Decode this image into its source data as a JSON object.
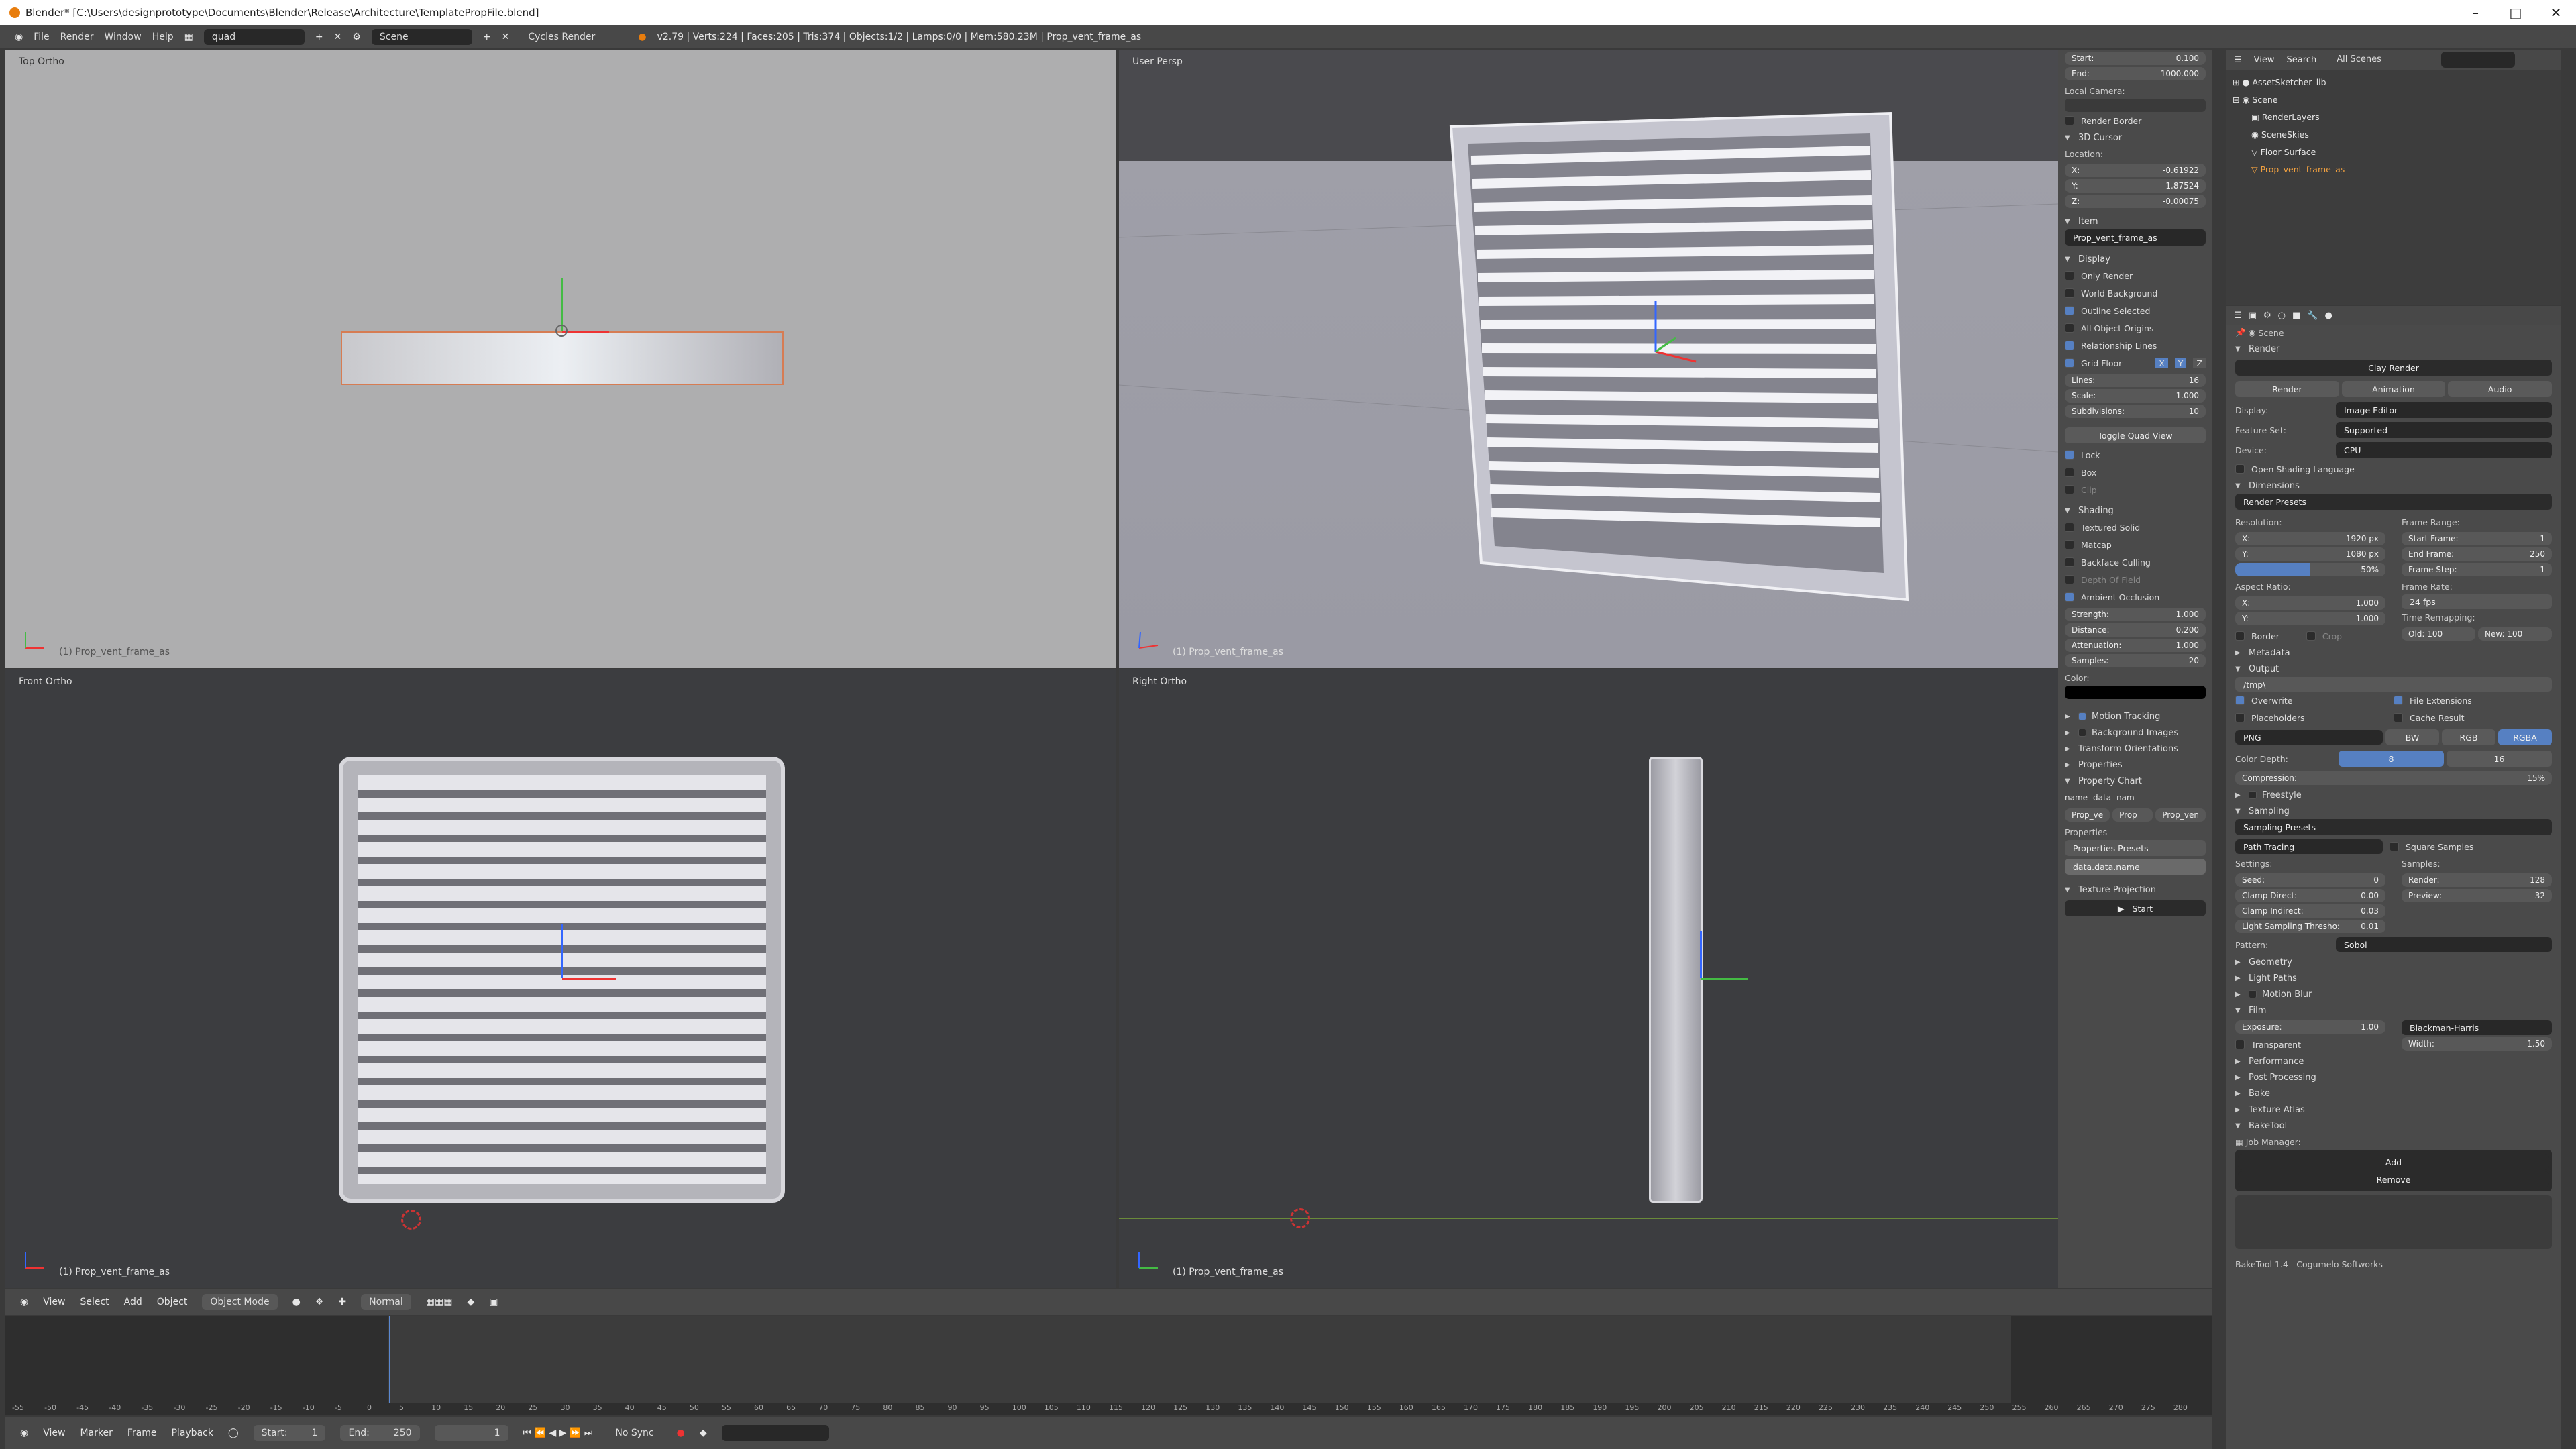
{
  "window": {
    "title": "Blender* [C:\\Users\\designprototype\\Documents\\Blender\\Release\\Architecture\\TemplatePropFile.blend]"
  },
  "topbar": {
    "menus": [
      "File",
      "Render",
      "Window",
      "Help"
    ],
    "screen": "quad",
    "scene": "Scene",
    "engine": "Cycles Render",
    "stats": "v2.79 | Verts:224 | Faces:205 | Tris:374 | Objects:1/2 | Lamps:0/0 | Mem:580.23M | Prop_vent_frame_as"
  },
  "viewports": {
    "top_left": "Top Ortho",
    "top_right": "User Persp",
    "bottom_left": "Front Ortho",
    "bottom_right": "Right Ortho",
    "object": "(1) Prop_vent_frame_as"
  },
  "npanel": {
    "clip_start": {
      "label": "Start:",
      "value": "0.100"
    },
    "clip_end": {
      "label": "End:",
      "value": "1000.000"
    },
    "local_camera": "Local Camera:",
    "render_border": "Render Border",
    "cursor_title": "3D Cursor",
    "location": "Location:",
    "cursor": [
      {
        "label": "X:",
        "value": "-0.61922"
      },
      {
        "label": "Y:",
        "value": "-1.87524"
      },
      {
        "label": "Z:",
        "value": "-0.00075"
      }
    ],
    "item_title": "Item",
    "item_name": "Prop_vent_frame_as",
    "display_title": "Display",
    "display_opts": [
      "Only Render",
      "World Background",
      "Outline Selected",
      "All Object Origins",
      "Relationship Lines"
    ],
    "grid_floor": "Grid Floor",
    "grid_axes": [
      "X",
      "Y",
      "Z"
    ],
    "grid": [
      {
        "label": "Lines:",
        "value": "16"
      },
      {
        "label": "Scale:",
        "value": "1.000"
      },
      {
        "label": "Subdivisions:",
        "value": "10"
      }
    ],
    "toggle_quad": "Toggle Quad View",
    "quad_opts": [
      "Lock",
      "Box",
      "Clip"
    ],
    "shading_title": "Shading",
    "shading_opts": [
      "Textured Solid",
      "Matcap",
      "Backface Culling",
      "Depth Of Field",
      "Ambient Occlusion"
    ],
    "ao": [
      {
        "label": "Strength:",
        "value": "1.000"
      },
      {
        "label": "Distance:",
        "value": "0.200"
      },
      {
        "label": "Attenuation:",
        "value": "1.000"
      },
      {
        "label": "Samples:",
        "value": "20"
      }
    ],
    "color": "Color:",
    "collapsed": [
      "Motion Tracking",
      "Background Images",
      "Transform Orientations",
      "Properties"
    ],
    "property_chart": "Property Chart",
    "pc_cols": [
      "name",
      "data",
      "nam"
    ],
    "pc_vals": [
      "Prop_ve",
      "Prop",
      "Prop_ven"
    ],
    "properties": "Properties",
    "props_presets": "Properties Presets",
    "data_path": "data.data.name",
    "texture_projection": "Texture Projection",
    "start": "Start"
  },
  "outliner": {
    "menus": [
      "View",
      "Search"
    ],
    "filter": "All Scenes",
    "items": [
      "AssetSketcher_lib",
      "Scene",
      "RenderLayers",
      "SceneSkies",
      "Floor Surface",
      "Prop_vent_frame_as"
    ]
  },
  "props": {
    "breadcrumb": "Scene",
    "render_title": "Render",
    "clay_render": "Clay Render",
    "tabs": [
      "Render",
      "Animation",
      "Audio"
    ],
    "display": {
      "label": "Display:",
      "value": "Image Editor"
    },
    "feature_set": {
      "label": "Feature Set:",
      "value": "Supported"
    },
    "device": {
      "label": "Device:",
      "value": "CPU"
    },
    "osl": "Open Shading Language",
    "dimensions": "Dimensions",
    "render_presets": "Render Presets",
    "resolution": "Resolution:",
    "res": [
      {
        "label": "X:",
        "value": "1920 px"
      },
      {
        "label": "Y:",
        "value": "1080 px"
      },
      {
        "label": "",
        "value": "50%"
      }
    ],
    "frame_range": "Frame Range:",
    "frames": [
      {
        "label": "Start Frame:",
        "value": "1"
      },
      {
        "label": "End Frame:",
        "value": "250"
      },
      {
        "label": "Frame Step:",
        "value": "1"
      }
    ],
    "aspect": "Aspect Ratio:",
    "asp": [
      {
        "label": "X:",
        "value": "1.000"
      },
      {
        "label": "Y:",
        "value": "1.000"
      }
    ],
    "frame_rate": "Frame Rate:",
    "fps": "24 fps",
    "time_remap": "Time Remapping:",
    "old": "Old: 100",
    "new": "New: 100",
    "border": "Border",
    "crop": "Crop",
    "metadata": "Metadata",
    "output": "Output",
    "path": "/tmp\\",
    "overwrite": "Overwrite",
    "file_ext": "File Extensions",
    "placeholders": "Placeholders",
    "cache": "Cache Result",
    "format": "PNG",
    "color_modes": [
      "BW",
      "RGB",
      "RGBA"
    ],
    "color_depth": "Color Depth:",
    "depths": [
      "8",
      "16"
    ],
    "compression": "Compression:",
    "compression_val": "15%",
    "freestyle": "Freestyle",
    "sampling": "Sampling",
    "sampling_presets": "Sampling Presets",
    "integrator": "Path Tracing",
    "square": "Square Samples",
    "settings": "Settings:",
    "samples": "Samples:",
    "seed": {
      "label": "Seed:",
      "value": "0"
    },
    "clamp_direct": {
      "label": "Clamp Direct:",
      "value": "0.00"
    },
    "clamp_indirect": {
      "label": "Clamp Indirect:",
      "value": "0.03"
    },
    "light_thresh": {
      "label": "Light Sampling Thresho:",
      "value": "0.01"
    },
    "render_samples": {
      "label": "Render:",
      "value": "128"
    },
    "preview_samples": {
      "label": "Preview:",
      "value": "32"
    },
    "pattern": {
      "label": "Pattern:",
      "value": "Sobol"
    },
    "geometry": "Geometry",
    "light_paths": "Light Paths",
    "motion_blur": "Motion Blur",
    "film": "Film",
    "exposure": {
      "label": "Exposure:",
      "value": "1.00"
    },
    "filter": "Blackman-Harris",
    "width": {
      "label": "Width:",
      "value": "1.50"
    },
    "transparent": "Transparent",
    "collapsed": [
      "Performance",
      "Post Processing",
      "Bake",
      "Texture Atlas"
    ],
    "baketool": "BakeTool",
    "job_manager": "Job Manager:",
    "add": "Add",
    "remove": "Remove",
    "footer": "BakeTool 1.4 - Cogumelo Softworks"
  },
  "header3d": {
    "menus": [
      "View",
      "Select",
      "Add",
      "Object"
    ],
    "mode": "Object Mode",
    "orientation": "Normal"
  },
  "timeline": {
    "menus": [
      "View",
      "Marker",
      "Frame",
      "Playback"
    ],
    "start": "Start:",
    "start_val": "1",
    "end": "End:",
    "end_val": "250",
    "current": "1",
    "sync": "No Sync",
    "ticks": [
      "-55",
      "-50",
      "-45",
      "-40",
      "-35",
      "-30",
      "-25",
      "-20",
      "-15",
      "-10",
      "-5",
      "0",
      "5",
      "10",
      "15",
      "20",
      "25",
      "30",
      "35",
      "40",
      "45",
      "50",
      "55",
      "60",
      "65",
      "70",
      "75",
      "80",
      "85",
      "90",
      "95",
      "100",
      "105",
      "110",
      "115",
      "120",
      "125",
      "130",
      "135",
      "140",
      "145",
      "150",
      "155",
      "160",
      "165",
      "170",
      "175",
      "180",
      "185",
      "190",
      "195",
      "200",
      "205",
      "210",
      "215",
      "220",
      "225",
      "230",
      "235",
      "240",
      "245",
      "250",
      "255",
      "260",
      "265",
      "270",
      "275",
      "280"
    ]
  }
}
